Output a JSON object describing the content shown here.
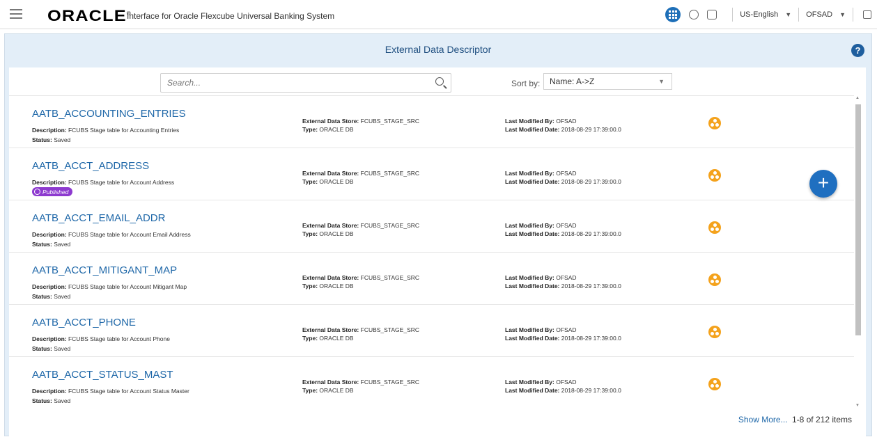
{
  "header": {
    "logo": "ORACLE",
    "logo_mark": "®",
    "app_title": "Interface for Oracle Flexcube Universal Banking System",
    "language": "US-English",
    "user": "OFSAD"
  },
  "page": {
    "title": "External Data Descriptor",
    "help": "?"
  },
  "search": {
    "placeholder": "Search..."
  },
  "sort": {
    "label": "Sort by:",
    "value": "Name: A->Z"
  },
  "labels": {
    "description": "Description:",
    "status": "Status:",
    "store": "External Data Store:",
    "type": "Type:",
    "modified_by": "Last Modified By:",
    "modified_date": "Last Modified Date:"
  },
  "rows": [
    {
      "name": "AATB_ACCOUNTING_ENTRIES",
      "description": "FCUBS Stage table for Accounting Entries",
      "status": "Saved",
      "store": "FCUBS_STAGE_SRC",
      "type": "ORACLE DB",
      "modified_by": "OFSAD",
      "modified_date": "2018-08-29 17:39:00.0"
    },
    {
      "name": "AATB_ACCT_ADDRESS",
      "description": "FCUBS Stage table for Account Address",
      "status": "Published",
      "store": "FCUBS_STAGE_SRC",
      "type": "ORACLE DB",
      "modified_by": "OFSAD",
      "modified_date": "2018-08-29 17:39:00.0"
    },
    {
      "name": "AATB_ACCT_EMAIL_ADDR",
      "description": "FCUBS Stage table for Account Email Address",
      "status": "Saved",
      "store": "FCUBS_STAGE_SRC",
      "type": "ORACLE DB",
      "modified_by": "OFSAD",
      "modified_date": "2018-08-29 17:39:00.0"
    },
    {
      "name": "AATB_ACCT_MITIGANT_MAP",
      "description": "FCUBS Stage table for Account Mitigant Map",
      "status": "Saved",
      "store": "FCUBS_STAGE_SRC",
      "type": "ORACLE DB",
      "modified_by": "OFSAD",
      "modified_date": "2018-08-29 17:39:00.0"
    },
    {
      "name": "AATB_ACCT_PHONE",
      "description": "FCUBS Stage table for Account Phone",
      "status": "Saved",
      "store": "FCUBS_STAGE_SRC",
      "type": "ORACLE DB",
      "modified_by": "OFSAD",
      "modified_date": "2018-08-29 17:39:00.0"
    },
    {
      "name": "AATB_ACCT_STATUS_MAST",
      "description": "FCUBS Stage table for Account Status Master",
      "status": "Saved",
      "store": "FCUBS_STAGE_SRC",
      "type": "ORACLE DB",
      "modified_by": "OFSAD",
      "modified_date": "2018-08-29 17:39:00.0"
    }
  ],
  "footer": {
    "show_more": "Show More...",
    "count": "1-8 of 212 items"
  },
  "colors": {
    "accent": "#1e6fb8",
    "link": "#1e67a8",
    "published": "#8d3acf",
    "row_icon": "#f4a21c"
  }
}
